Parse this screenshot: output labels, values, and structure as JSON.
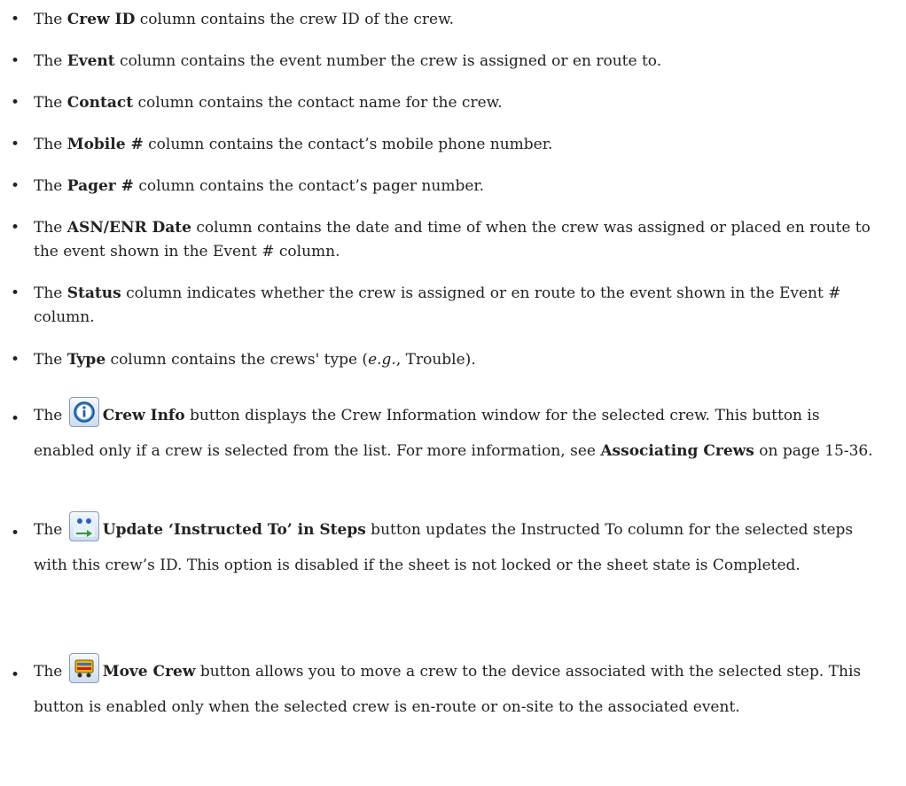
{
  "items": [
    {
      "pre": "The ",
      "bold": "Crew ID",
      "post": " column contains the crew ID of the crew."
    },
    {
      "pre": "The ",
      "bold": "Event",
      "post": " column contains the event number the crew is assigned or en route to."
    },
    {
      "pre": "The ",
      "bold": "Contact",
      "post": " column contains the contact name for the crew."
    },
    {
      "pre": "The ",
      "bold": "Mobile #",
      "post": " column contains the contact’s mobile phone number."
    },
    {
      "pre": "The ",
      "bold": "Pager #",
      "post": " column contains the contact’s pager number."
    },
    {
      "pre": "The ",
      "bold": "ASN/ENR Date",
      "post": " column contains the date and time of when the crew was assigned or placed en route to the event shown in the Event # column."
    },
    {
      "pre": "The ",
      "bold": "Status",
      "post": " column indicates whether the crew is assigned or en route to the event shown in the Event # column."
    },
    {
      "pre": "The ",
      "bold": "Type",
      "post": " column contains the crews' type (",
      "italic": "e.g.",
      "post2": ", Trouble)."
    },
    {
      "pre": "The ",
      "bold": "Crew Info",
      "post": " button displays the Crew Information window for the selected crew. This button is enabled only if a crew is selected from the list. For more information, see ",
      "link_bold": "Associating Crews",
      "post2": " on page 15-36.",
      "icon": "info-icon"
    },
    {
      "pre": "The ",
      "bold": "Update ‘Instructed To’ in Steps",
      "post": " button updates the Instructed To column for the selected steps with this crew’s ID. This option is disabled if the sheet is not locked or the sheet state is Completed.",
      "icon": "crew-swap-icon"
    },
    {
      "pre": "The ",
      "bold": "Move Crew",
      "post": " button allows you to move a crew to the device associated with the selected step. This button is enabled only when the selected crew is en-route or on-site to the associated event.",
      "icon": "truck-icon"
    }
  ],
  "bullet": "•"
}
